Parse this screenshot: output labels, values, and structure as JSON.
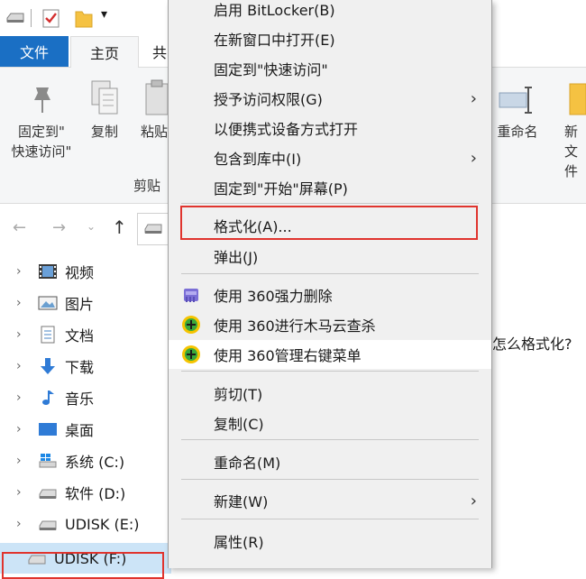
{
  "ribbon_tabs": {
    "file": "文件",
    "home": "主页",
    "share_partial": "共"
  },
  "ribbon": {
    "pin_quick_access": "固定到\"\n快速访问\"",
    "pin_line1": "固定到\"",
    "pin_line2": "快速访问\"",
    "copy": "复制",
    "paste_partial": "粘贴",
    "clipboard_group_partial": "剪贴",
    "rename": "重命名",
    "new_partial_line1": "新",
    "new_partial_line2": "文件"
  },
  "content_text": "怎么格式化?",
  "nav": [
    {
      "label": "视频",
      "icon": "video-icon"
    },
    {
      "label": "图片",
      "icon": "picture-icon"
    },
    {
      "label": "文档",
      "icon": "document-icon"
    },
    {
      "label": "下载",
      "icon": "download-icon"
    },
    {
      "label": "音乐",
      "icon": "music-icon"
    },
    {
      "label": "桌面",
      "icon": "desktop-icon"
    },
    {
      "label": "系统 (C:)",
      "icon": "system-drive-icon"
    },
    {
      "label": "软件 (D:)",
      "icon": "drive-icon"
    },
    {
      "label": "UDISK (E:)",
      "icon": "usb-drive-icon"
    },
    {
      "label": "UDISK (F:)",
      "icon": "usb-drive-icon"
    }
  ],
  "menu": {
    "bitlocker": "启用 BitLocker(B)",
    "open_new_window": "在新窗口中打开(E)",
    "pin_quick": "固定到\"快速访问\"",
    "grant_access": "授予访问权限(G)",
    "portable_open": "以便携式设备方式打开",
    "include_library": "包含到库中(I)",
    "pin_start": "固定到\"开始\"屏幕(P)",
    "format": "格式化(A)...",
    "eject": "弹出(J)",
    "del360": "使用 360强力删除",
    "scan360": "使用 360进行木马云查杀",
    "manage360": "使用 360管理右键菜单",
    "cut": "剪切(T)",
    "copy": "复制(C)",
    "rename": "重命名(M)",
    "new": "新建(W)",
    "properties": "属性(R)"
  },
  "colors": {
    "accent": "#1a6fc4",
    "highlight_box": "#e0342e",
    "menu_bg": "#f0f0f0"
  }
}
